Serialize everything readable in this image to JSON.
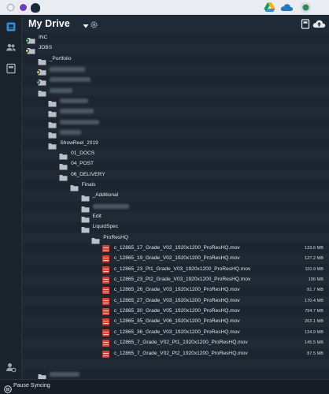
{
  "header": {
    "title": "My Drive"
  },
  "footer": {
    "pause_label": "Pause Syncing"
  },
  "colors": {
    "accent": "#2d8fd8",
    "folder": "#b9c0c6",
    "file": "#e23b2e",
    "badge_green": "#35c24b",
    "badge_yellow": "#e8c23a"
  },
  "rows": [
    {
      "type": "folder",
      "depth": 0,
      "label": "INC",
      "badge": "green"
    },
    {
      "type": "folder",
      "depth": 0,
      "label": "JOBS",
      "badge": "yellow"
    },
    {
      "type": "folder",
      "depth": 1,
      "label": "_Portfolio"
    },
    {
      "type": "folder",
      "depth": 1,
      "label": "",
      "redacted": true,
      "badge": "yellow"
    },
    {
      "type": "folder",
      "depth": 1,
      "label": "",
      "redacted": true,
      "badge": "green"
    },
    {
      "type": "folder",
      "depth": 1,
      "label": "",
      "redacted": true
    },
    {
      "type": "folder",
      "depth": 2,
      "label": "",
      "redacted": true
    },
    {
      "type": "folder",
      "depth": 2,
      "label": "",
      "redacted": true
    },
    {
      "type": "folder",
      "depth": 2,
      "label": "",
      "redacted": true
    },
    {
      "type": "folder",
      "depth": 2,
      "label": "",
      "redacted": true
    },
    {
      "type": "folder",
      "depth": 2,
      "label": "ShowReel_2019"
    },
    {
      "type": "folder",
      "depth": 3,
      "label": "01_DOCS"
    },
    {
      "type": "folder",
      "depth": 3,
      "label": "04_POST"
    },
    {
      "type": "folder",
      "depth": 3,
      "label": "06_DELIVERY"
    },
    {
      "type": "folder",
      "depth": 4,
      "label": "Finals"
    },
    {
      "type": "folder",
      "depth": 5,
      "label": "_Additional"
    },
    {
      "type": "folder",
      "depth": 5,
      "label": "",
      "redacted": true
    },
    {
      "type": "folder",
      "depth": 5,
      "label": "Edit"
    },
    {
      "type": "folder",
      "depth": 5,
      "label": "LiquidSpec"
    },
    {
      "type": "folder",
      "depth": 6,
      "label": "ProResHQ"
    },
    {
      "type": "file",
      "depth": 7,
      "label": "c_12865_17_Grade_V02_1920x1200_ProResHQ.mov",
      "size": "133.6 MB"
    },
    {
      "type": "file",
      "depth": 7,
      "label": "c_12865_19_Grade_V02_1920x1200_ProResHQ.mov",
      "size": "127.2 MB"
    },
    {
      "type": "file",
      "depth": 7,
      "label": "c_12865_23_Pt1_Grade_V03_1920x1200_ProResHQ.mov",
      "size": "110.9 MB"
    },
    {
      "type": "file",
      "depth": 7,
      "label": "c_12865_23_Pt2_Grade_V03_1920x1200_ProResHQ.mov",
      "size": "106 MB"
    },
    {
      "type": "file",
      "depth": 7,
      "label": "c_12865_26_Grade_V03_1920x1200_ProResHQ.mov",
      "size": "81.7 MB"
    },
    {
      "type": "file",
      "depth": 7,
      "label": "c_12865_27_Grade_V03_1920x1200_ProResHQ.mov",
      "size": "170.4 MB"
    },
    {
      "type": "file",
      "depth": 7,
      "label": "c_12865_30_Grade_V05_1920x1200_ProResHQ.mov",
      "size": "794.7 MB"
    },
    {
      "type": "file",
      "depth": 7,
      "label": "c_12865_35_Grade_V06_1920x1200_ProResHQ.mov",
      "size": "262.1 MB"
    },
    {
      "type": "file",
      "depth": 7,
      "label": "c_12865_36_Grade_V03_1920x1200_ProResHQ.mov",
      "size": "134.9 MB"
    },
    {
      "type": "file",
      "depth": 7,
      "label": "c_12865_7_Grade_V02_Pt1_1920x1200_ProResHQ.mov",
      "size": "145.5 MB"
    },
    {
      "type": "file",
      "depth": 7,
      "label": "c_12865_7_Grade_V02_Pt2_1920x1200_ProResHQ.mov",
      "size": "87.5 MB"
    },
    {
      "type": "spacer"
    },
    {
      "type": "folder",
      "depth": 1,
      "label": "",
      "redacted": true
    }
  ]
}
